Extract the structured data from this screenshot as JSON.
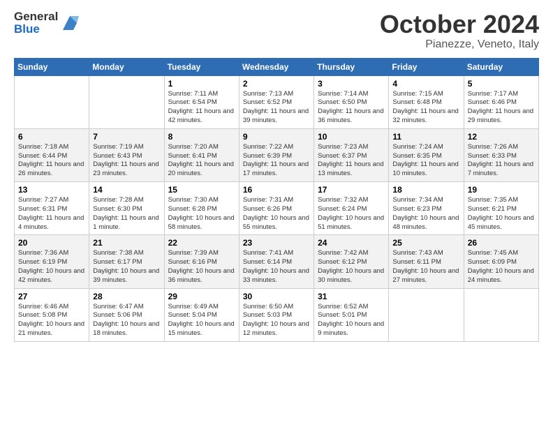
{
  "header": {
    "logo_line1": "General",
    "logo_line2": "Blue",
    "title": "October 2024",
    "location": "Pianezze, Veneto, Italy"
  },
  "weekdays": [
    "Sunday",
    "Monday",
    "Tuesday",
    "Wednesday",
    "Thursday",
    "Friday",
    "Saturday"
  ],
  "weeks": [
    [
      {
        "day": "",
        "sunrise": "",
        "sunset": "",
        "daylight": ""
      },
      {
        "day": "",
        "sunrise": "",
        "sunset": "",
        "daylight": ""
      },
      {
        "day": "1",
        "sunrise": "Sunrise: 7:11 AM",
        "sunset": "Sunset: 6:54 PM",
        "daylight": "Daylight: 11 hours and 42 minutes."
      },
      {
        "day": "2",
        "sunrise": "Sunrise: 7:13 AM",
        "sunset": "Sunset: 6:52 PM",
        "daylight": "Daylight: 11 hours and 39 minutes."
      },
      {
        "day": "3",
        "sunrise": "Sunrise: 7:14 AM",
        "sunset": "Sunset: 6:50 PM",
        "daylight": "Daylight: 11 hours and 36 minutes."
      },
      {
        "day": "4",
        "sunrise": "Sunrise: 7:15 AM",
        "sunset": "Sunset: 6:48 PM",
        "daylight": "Daylight: 11 hours and 32 minutes."
      },
      {
        "day": "5",
        "sunrise": "Sunrise: 7:17 AM",
        "sunset": "Sunset: 6:46 PM",
        "daylight": "Daylight: 11 hours and 29 minutes."
      }
    ],
    [
      {
        "day": "6",
        "sunrise": "Sunrise: 7:18 AM",
        "sunset": "Sunset: 6:44 PM",
        "daylight": "Daylight: 11 hours and 26 minutes."
      },
      {
        "day": "7",
        "sunrise": "Sunrise: 7:19 AM",
        "sunset": "Sunset: 6:43 PM",
        "daylight": "Daylight: 11 hours and 23 minutes."
      },
      {
        "day": "8",
        "sunrise": "Sunrise: 7:20 AM",
        "sunset": "Sunset: 6:41 PM",
        "daylight": "Daylight: 11 hours and 20 minutes."
      },
      {
        "day": "9",
        "sunrise": "Sunrise: 7:22 AM",
        "sunset": "Sunset: 6:39 PM",
        "daylight": "Daylight: 11 hours and 17 minutes."
      },
      {
        "day": "10",
        "sunrise": "Sunrise: 7:23 AM",
        "sunset": "Sunset: 6:37 PM",
        "daylight": "Daylight: 11 hours and 13 minutes."
      },
      {
        "day": "11",
        "sunrise": "Sunrise: 7:24 AM",
        "sunset": "Sunset: 6:35 PM",
        "daylight": "Daylight: 11 hours and 10 minutes."
      },
      {
        "day": "12",
        "sunrise": "Sunrise: 7:26 AM",
        "sunset": "Sunset: 6:33 PM",
        "daylight": "Daylight: 11 hours and 7 minutes."
      }
    ],
    [
      {
        "day": "13",
        "sunrise": "Sunrise: 7:27 AM",
        "sunset": "Sunset: 6:31 PM",
        "daylight": "Daylight: 11 hours and 4 minutes."
      },
      {
        "day": "14",
        "sunrise": "Sunrise: 7:28 AM",
        "sunset": "Sunset: 6:30 PM",
        "daylight": "Daylight: 11 hours and 1 minute."
      },
      {
        "day": "15",
        "sunrise": "Sunrise: 7:30 AM",
        "sunset": "Sunset: 6:28 PM",
        "daylight": "Daylight: 10 hours and 58 minutes."
      },
      {
        "day": "16",
        "sunrise": "Sunrise: 7:31 AM",
        "sunset": "Sunset: 6:26 PM",
        "daylight": "Daylight: 10 hours and 55 minutes."
      },
      {
        "day": "17",
        "sunrise": "Sunrise: 7:32 AM",
        "sunset": "Sunset: 6:24 PM",
        "daylight": "Daylight: 10 hours and 51 minutes."
      },
      {
        "day": "18",
        "sunrise": "Sunrise: 7:34 AM",
        "sunset": "Sunset: 6:23 PM",
        "daylight": "Daylight: 10 hours and 48 minutes."
      },
      {
        "day": "19",
        "sunrise": "Sunrise: 7:35 AM",
        "sunset": "Sunset: 6:21 PM",
        "daylight": "Daylight: 10 hours and 45 minutes."
      }
    ],
    [
      {
        "day": "20",
        "sunrise": "Sunrise: 7:36 AM",
        "sunset": "Sunset: 6:19 PM",
        "daylight": "Daylight: 10 hours and 42 minutes."
      },
      {
        "day": "21",
        "sunrise": "Sunrise: 7:38 AM",
        "sunset": "Sunset: 6:17 PM",
        "daylight": "Daylight: 10 hours and 39 minutes."
      },
      {
        "day": "22",
        "sunrise": "Sunrise: 7:39 AM",
        "sunset": "Sunset: 6:16 PM",
        "daylight": "Daylight: 10 hours and 36 minutes."
      },
      {
        "day": "23",
        "sunrise": "Sunrise: 7:41 AM",
        "sunset": "Sunset: 6:14 PM",
        "daylight": "Daylight: 10 hours and 33 minutes."
      },
      {
        "day": "24",
        "sunrise": "Sunrise: 7:42 AM",
        "sunset": "Sunset: 6:12 PM",
        "daylight": "Daylight: 10 hours and 30 minutes."
      },
      {
        "day": "25",
        "sunrise": "Sunrise: 7:43 AM",
        "sunset": "Sunset: 6:11 PM",
        "daylight": "Daylight: 10 hours and 27 minutes."
      },
      {
        "day": "26",
        "sunrise": "Sunrise: 7:45 AM",
        "sunset": "Sunset: 6:09 PM",
        "daylight": "Daylight: 10 hours and 24 minutes."
      }
    ],
    [
      {
        "day": "27",
        "sunrise": "Sunrise: 6:46 AM",
        "sunset": "Sunset: 5:08 PM",
        "daylight": "Daylight: 10 hours and 21 minutes."
      },
      {
        "day": "28",
        "sunrise": "Sunrise: 6:47 AM",
        "sunset": "Sunset: 5:06 PM",
        "daylight": "Daylight: 10 hours and 18 minutes."
      },
      {
        "day": "29",
        "sunrise": "Sunrise: 6:49 AM",
        "sunset": "Sunset: 5:04 PM",
        "daylight": "Daylight: 10 hours and 15 minutes."
      },
      {
        "day": "30",
        "sunrise": "Sunrise: 6:50 AM",
        "sunset": "Sunset: 5:03 PM",
        "daylight": "Daylight: 10 hours and 12 minutes."
      },
      {
        "day": "31",
        "sunrise": "Sunrise: 6:52 AM",
        "sunset": "Sunset: 5:01 PM",
        "daylight": "Daylight: 10 hours and 9 minutes."
      },
      {
        "day": "",
        "sunrise": "",
        "sunset": "",
        "daylight": ""
      },
      {
        "day": "",
        "sunrise": "",
        "sunset": "",
        "daylight": ""
      }
    ]
  ]
}
